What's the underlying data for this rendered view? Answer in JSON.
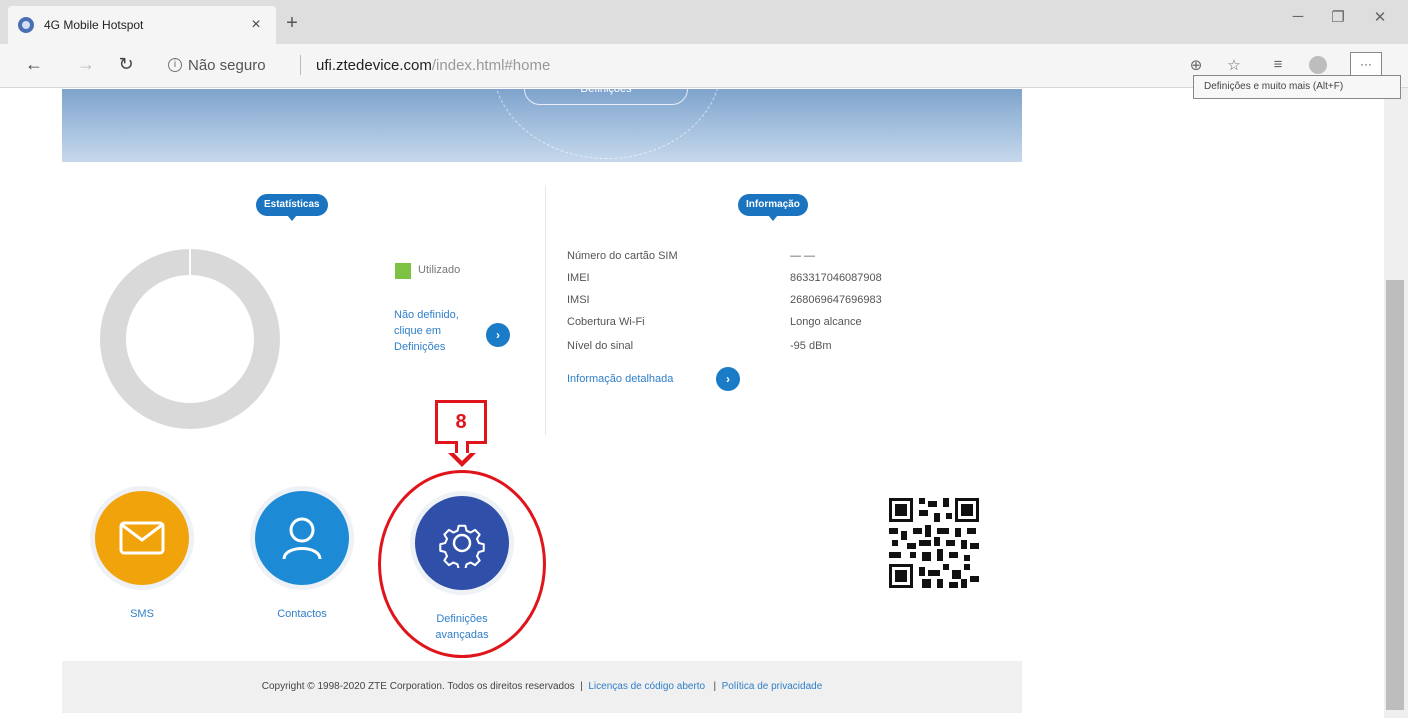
{
  "browser": {
    "tab_title": "4G Mobile Hotspot",
    "tab_close": "×",
    "new_tab": "+",
    "address": {
      "security": "Não seguro",
      "host": "ufi.ztedevice.com",
      "path": "/index.html#home"
    },
    "menu_label": "···",
    "tooltip": "Definições e muito mais (Alt+F)"
  },
  "banner": {
    "pill_label": "Definições"
  },
  "statistics": {
    "badge": "Estatísticas",
    "legend_used": "Utilizado",
    "not_defined_link": "Não definido, clique em Definições",
    "colors": {
      "used": "#7dc242",
      "empty": "#d9d9d9"
    }
  },
  "information": {
    "badge": "Informação",
    "rows": [
      {
        "label": "Número do cartão SIM",
        "value": "— —"
      },
      {
        "label": "IMEI",
        "value": "863317046087908"
      },
      {
        "label": "IMSI",
        "value": "268069647696983"
      },
      {
        "label": "Cobertura Wi-Fi",
        "value": "Longo alcance"
      },
      {
        "label": "Nível do sinal",
        "value": "-95 dBm"
      }
    ],
    "details_link": "Informação detalhada"
  },
  "annotation": {
    "step": "8",
    "color": "#e0141b"
  },
  "apps": [
    {
      "label": "SMS",
      "icon": "envelope-icon",
      "color": "#f0a30a"
    },
    {
      "label": "Contactos",
      "icon": "person-icon",
      "color": "#1d8ad6"
    },
    {
      "label_line1": "Definições",
      "label_line2": "avançadas",
      "icon": "gear-icon",
      "color": "#2f4fa8"
    }
  ],
  "footer": {
    "copyright": "Copyright © 1998-2020 ZTE Corporation. Todos os direitos reservados",
    "sep": "|",
    "open_source": "Licenças de código aberto",
    "privacy": "Política de privacidade"
  }
}
